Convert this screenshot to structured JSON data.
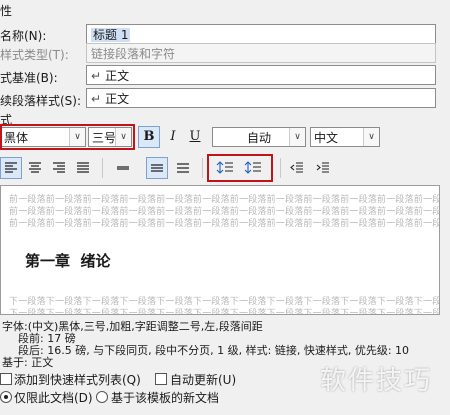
{
  "section": {
    "properties": "性",
    "format": "式"
  },
  "name": {
    "label": "名称(N):",
    "value": "标题 1"
  },
  "style_type": {
    "label": "样式类型(T):",
    "value": "链接段落和字符"
  },
  "based_on": {
    "label": "式基准(B):",
    "value": "正文"
  },
  "following": {
    "label": "续段落样式(S):",
    "value": "正文"
  },
  "font": {
    "name": "黑体",
    "size": "三号",
    "bold": "B",
    "italic": "I",
    "underline": "U",
    "color": "自动",
    "script": "中文"
  },
  "preview": {
    "prev_para_line": "前一段落前一段落前一段落前一段落前一段落前一段落前一段落前一段落前一段落前一段落前一段落前一段落前一段落前一段落",
    "sample_text": "第一章  绪论",
    "next_para_line": "下一段落下一段落下一段落下一段落下一段落下一段落下一段落下一段落下一段落下一段落下一段落下一段落下一段落下一段落"
  },
  "description": {
    "line1": "字体:(中文)黑体,三号,加粗,字距调整二号,左,段落间距",
    "line2": "段前: 17 磅",
    "line3": "段后: 16.5 磅, 与下段同页, 段中不分页, 1 级, 样式: 链接, 快速样式, 优先级: 10",
    "line4": "基于: 正文"
  },
  "options": {
    "add_quick": "添加到快速样式列表(Q)",
    "auto_update": "自动更新(U)",
    "only_doc": "仅限此文档(D)",
    "new_docs": "基于该模板的新文档"
  },
  "watermark": "软件技巧",
  "colors": {
    "highlight_box": "#c0141b",
    "selection": "#cfe0f5"
  }
}
